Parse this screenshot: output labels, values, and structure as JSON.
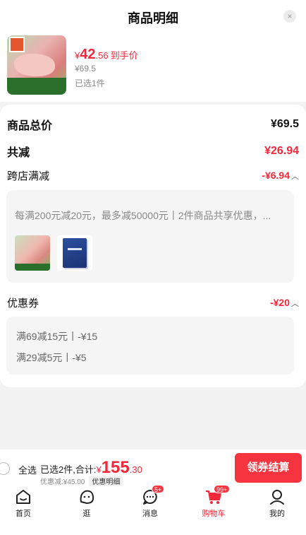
{
  "header": {
    "title": "商品明细",
    "close_label": "×"
  },
  "product": {
    "currency": "¥",
    "price_int": "42",
    "price_dec": ".56",
    "price_suffix": "到手价",
    "original_price": "¥69.5",
    "quantity_text": "已选1件"
  },
  "summary": {
    "total_label": "商品总价",
    "total_value": "¥69.5",
    "reduce_label": "共减",
    "reduce_value": "¥26.94"
  },
  "store_discount": {
    "label": "跨店满减",
    "value": "-¥6.94",
    "description": "每满200元减20元，最多减50000元丨2件商品共享优惠，..."
  },
  "coupons": {
    "label": "优惠券",
    "value": "-¥20",
    "items": [
      "满69减15元丨-¥15",
      "满29减5元丨-¥5"
    ]
  },
  "checkout": {
    "select_all": "全选",
    "selected_text": "已选2件,合计:",
    "currency": "¥",
    "total_int": "155",
    "total_dec": ".30",
    "discount_text": "优惠减:¥45.00",
    "detail_label": "优惠明细",
    "pay_label": "领券结算"
  },
  "tabbar": {
    "items": [
      {
        "label": "首页",
        "icon": "home-icon"
      },
      {
        "label": "逛",
        "icon": "browse-face-icon"
      },
      {
        "label": "消息",
        "icon": "message-icon",
        "badge": "5+"
      },
      {
        "label": "购物车",
        "icon": "cart-icon",
        "badge": "99+",
        "active": true
      },
      {
        "label": "我的",
        "icon": "profile-icon"
      }
    ]
  },
  "colors": {
    "accent": "#f0283a",
    "pay_button": "#f5343f",
    "background": "#f2f2f2"
  }
}
